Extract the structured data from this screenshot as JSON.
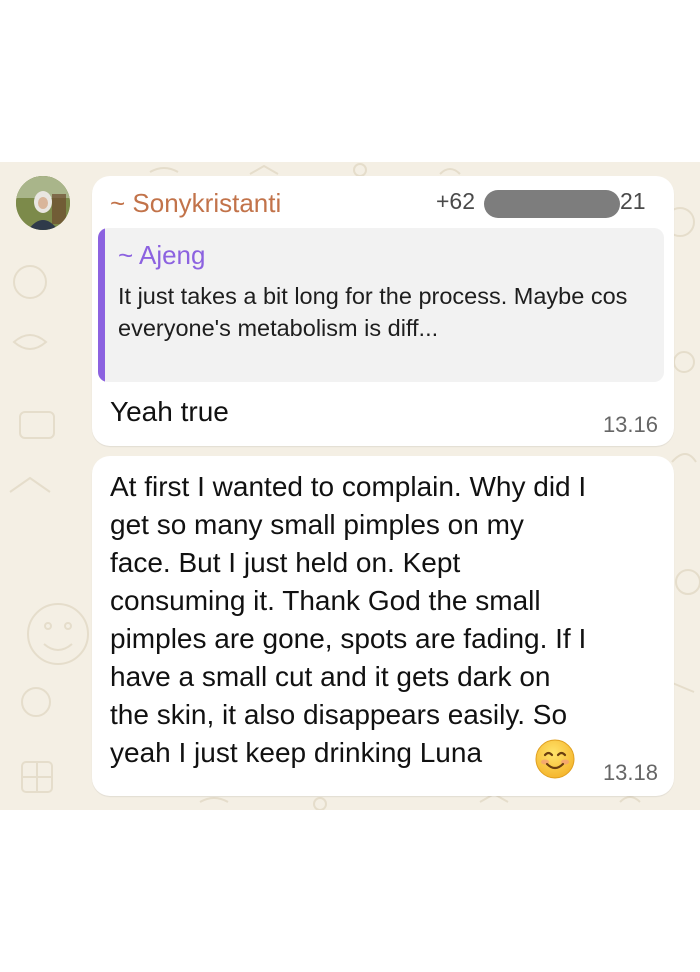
{
  "colors": {
    "chat_background": "#f4efe4",
    "bubble": "#ffffff",
    "sender_name": "#c2734a",
    "quote_accent": "#8c62e0",
    "quote_background": "#f2f2f2"
  },
  "icons": {
    "avatar": "profile-photo",
    "emoji": "smiling-face-with-smiling-eyes"
  },
  "message_1": {
    "sender_name": "~ Sonykristanti",
    "phone_prefix": "+62",
    "phone_suffix": "21",
    "quote": {
      "author": "~ Ajeng",
      "text": "It just takes a bit long for the process. Maybe cos everyone's metabolism is diff..."
    },
    "text": "Yeah true",
    "time": "13.16"
  },
  "message_2": {
    "text": "At first I wanted to complain. Why did I\nget so many small pimples on my\nface. But I just held on. Kept\nconsuming it. Thank God the small\npimples are gone, spots are fading. If I\nhave a small cut and it gets dark on\nthe skin, it also disappears easily. So\nyeah I just keep drinking Luna",
    "time": "13.18"
  }
}
